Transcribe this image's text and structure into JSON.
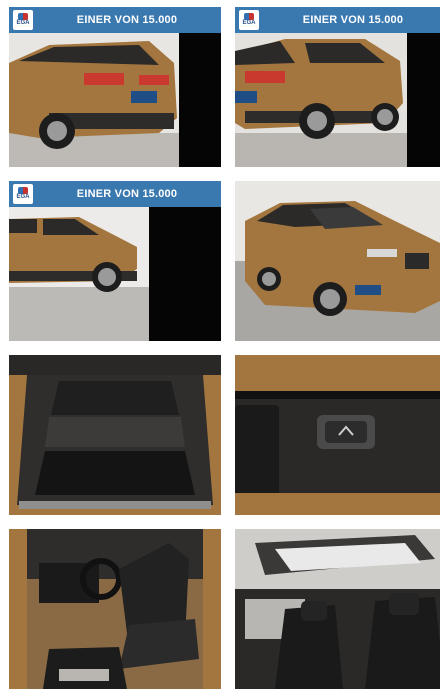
{
  "banner": {
    "text": "EINER VON 15.000",
    "logo_text": "EGA"
  },
  "tiles": [
    {
      "name": "exterior-rear-left",
      "has_banner": true
    },
    {
      "name": "exterior-rear-right",
      "has_banner": true
    },
    {
      "name": "exterior-side-left",
      "has_banner": true
    },
    {
      "name": "exterior-front",
      "has_banner": false
    },
    {
      "name": "trunk-interior",
      "has_banner": false
    },
    {
      "name": "tailgate-button",
      "has_banner": false
    },
    {
      "name": "driver-interior",
      "has_banner": false
    },
    {
      "name": "panoramic-sunroof",
      "has_banner": false
    }
  ],
  "colors": {
    "banner_bg": "#3a78b0",
    "car_body": "#a4763f"
  }
}
